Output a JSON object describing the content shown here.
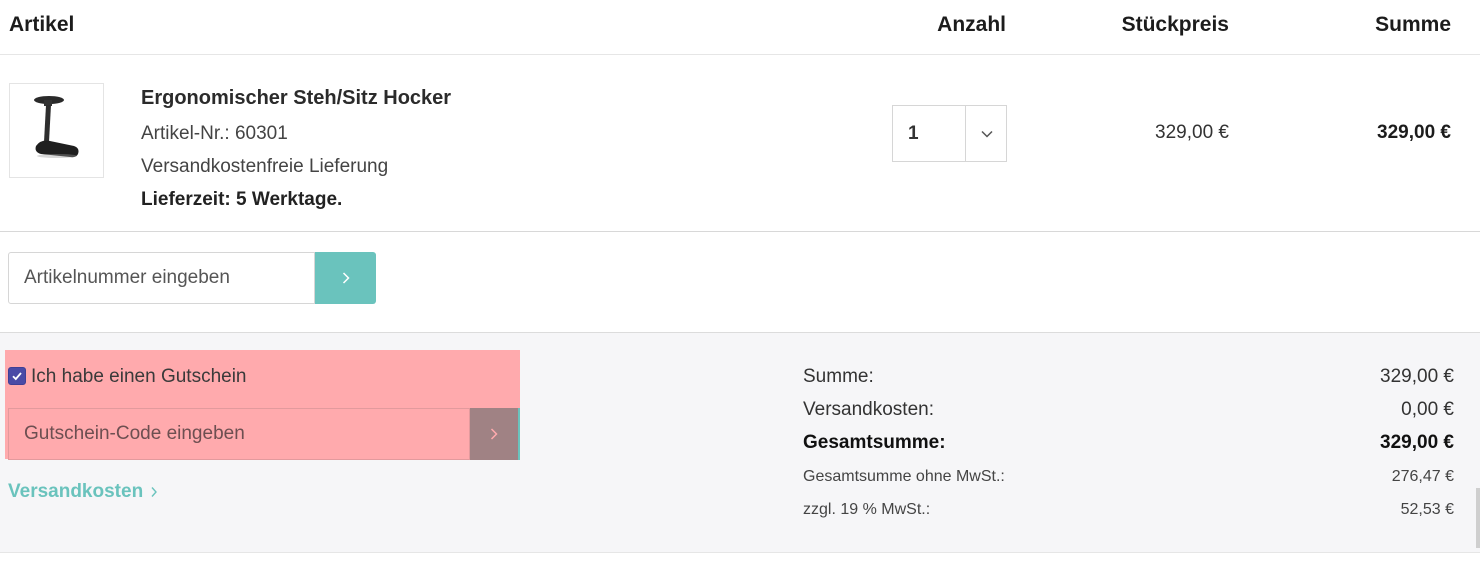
{
  "table_header": {
    "article": "Artikel",
    "quantity": "Anzahl",
    "unit_price": "Stückpreis",
    "sum": "Summe"
  },
  "item": {
    "name": "Ergonomischer Steh/Sitz Hocker",
    "article_number": "Artikel-Nr.: 60301",
    "shipping_note": "Versandkostenfreie Lieferung",
    "delivery_time": "Lieferzeit: 5 Werktage.",
    "quantity": "1",
    "unit_price": "329,00 €",
    "total": "329,00 €",
    "thumbnail_icon": "stool-image"
  },
  "add_by_number": {
    "placeholder": "Artikelnummer eingeben",
    "button_icon": "chevron-right-icon"
  },
  "voucher": {
    "checkbox_label": "Ich habe einen Gutschein",
    "checked": true,
    "placeholder": "Gutschein-Code eingeben",
    "button_icon": "chevron-right-icon"
  },
  "shipping_link": {
    "label": "Versandkosten"
  },
  "totals": {
    "subtotal_label": "Summe:",
    "subtotal_value": "329,00 €",
    "shipping_label": "Versandkosten:",
    "shipping_value": "0,00 €",
    "grand_label": "Gesamtsumme:",
    "grand_value": "329,00 €",
    "net_label": "Gesamtsumme ohne MwSt.:",
    "net_value": "276,47 €",
    "vat_label": "zzgl. 19 % MwSt.:",
    "vat_value": "52,53 €"
  },
  "colors": {
    "accent": "#6ac3bd",
    "highlight": "#ffaaad",
    "checkbox": "#4a4aa6",
    "footer_bg": "#f6f6f8"
  }
}
